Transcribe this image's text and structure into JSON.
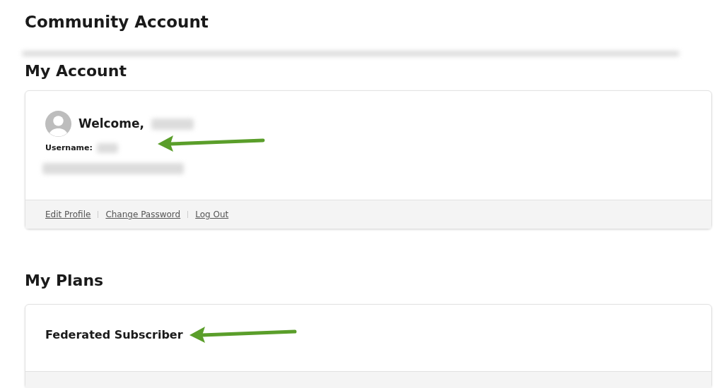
{
  "page_title": "Community Account",
  "account": {
    "heading": "My Account",
    "welcome": "Welcome,",
    "username_label": "Username:",
    "links": [
      "Edit Profile",
      "Change Password",
      "Log Out"
    ]
  },
  "plans": {
    "heading": "My Plans",
    "plan_name": "Federated Subscriber"
  }
}
